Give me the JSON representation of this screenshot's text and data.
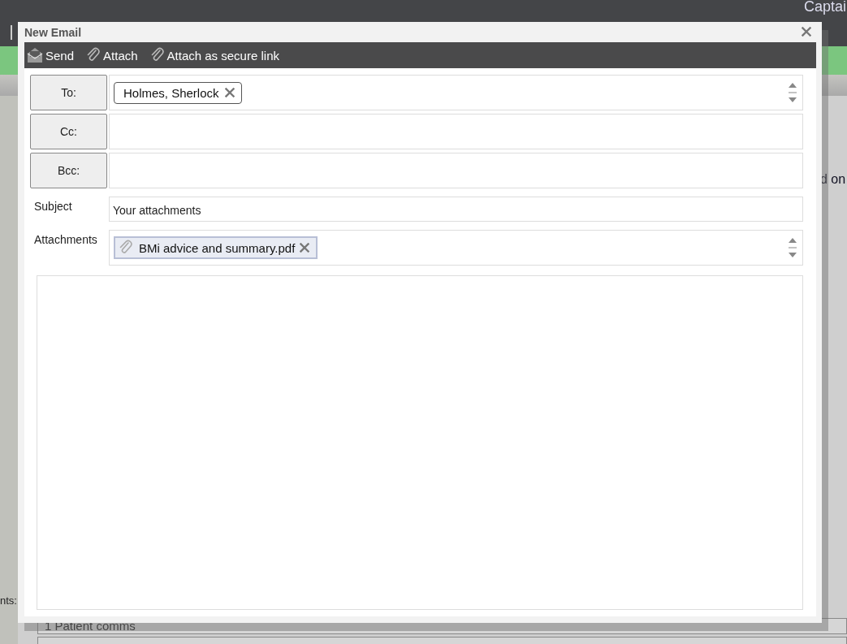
{
  "background": {
    "header_text": "Captai",
    "right_text": "d on",
    "side_label": "nts:",
    "list_rows": [
      "1 Patient comms"
    ]
  },
  "dialog": {
    "title": "New Email",
    "toolbar": [
      {
        "label": "Send"
      },
      {
        "label": "Attach"
      },
      {
        "label": "Attach as secure link"
      }
    ],
    "recipients": [
      {
        "label": "To:",
        "chips": [
          "Holmes, Sherlock"
        ],
        "spinner": true
      },
      {
        "label": "Cc:",
        "spinner": false
      },
      {
        "label": "Bcc:",
        "spinner": false
      }
    ],
    "subject": {
      "label": "Subject",
      "value": "Your attachments"
    },
    "attachments": {
      "label": "Attachments",
      "files": [
        "BMi advice and summary.pdf"
      ],
      "spinner": true
    }
  }
}
